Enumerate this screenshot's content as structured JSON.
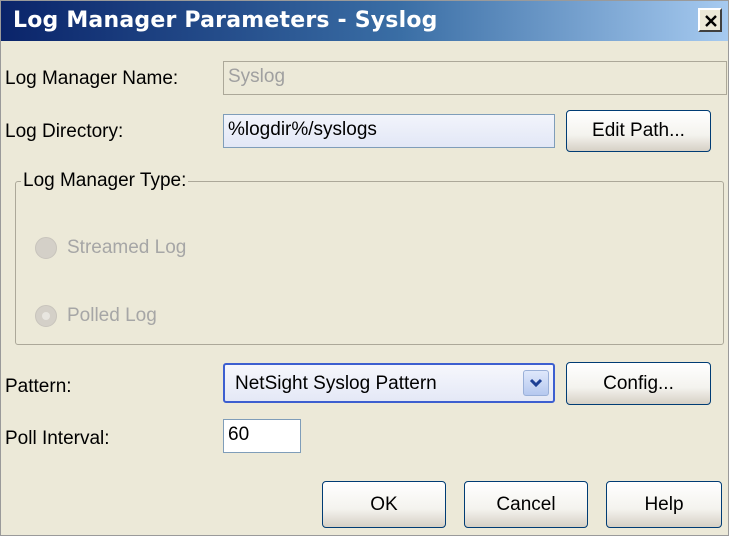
{
  "window": {
    "title": "Log Manager Parameters - Syslog"
  },
  "form": {
    "name_label": "Log Manager Name:",
    "name_value": "Syslog",
    "directory_label": "Log Directory:",
    "directory_value": "%logdir%/syslogs",
    "edit_path_label": "Edit Path...",
    "type_group_label": "Log Manager Type:",
    "type_options": [
      {
        "label": "Streamed Log",
        "selected": false
      },
      {
        "label": "Polled Log",
        "selected": true
      }
    ],
    "pattern_label": "Pattern:",
    "pattern_value": "NetSight Syslog Pattern",
    "config_label": "Config...",
    "poll_interval_label": "Poll Interval:",
    "poll_interval_value": "60"
  },
  "buttons": {
    "ok": "OK",
    "cancel": "Cancel",
    "help": "Help"
  },
  "colors": {
    "titlebar": "#0a246a",
    "dialog_bg": "#ece9d8",
    "focus_border": "#3d5fd0"
  },
  "icons": {
    "close": "close-icon",
    "dropdown": "chevron-down-icon"
  }
}
